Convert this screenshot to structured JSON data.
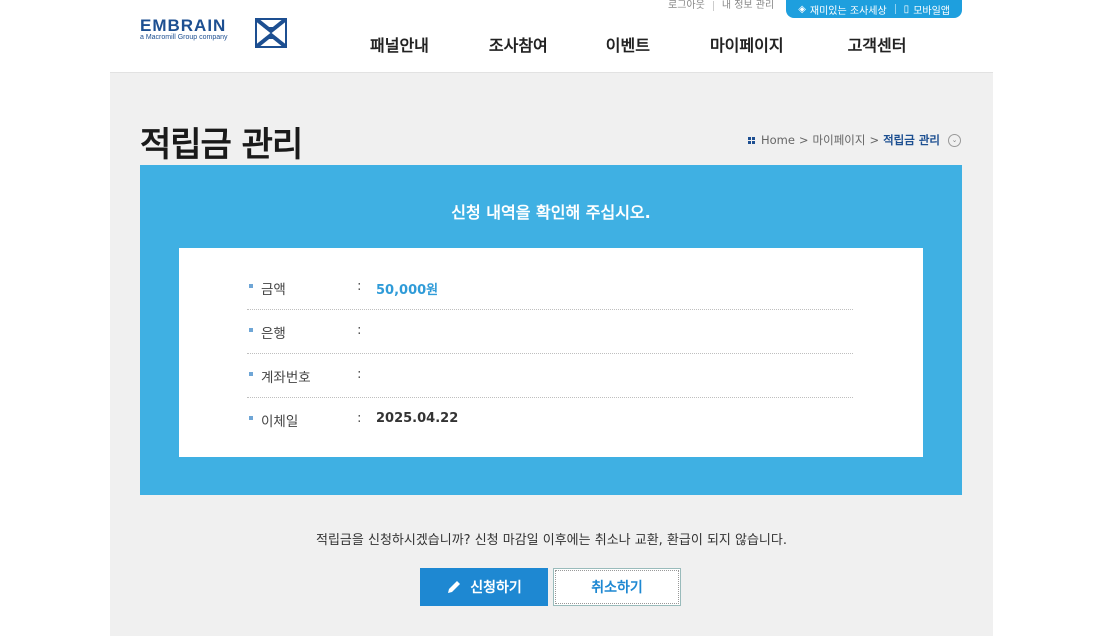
{
  "header": {
    "logo": {
      "name": "EMBRAIN",
      "sub": "a Macromill Group company"
    },
    "util_links": [
      "로그아웃",
      "내 정보 관리"
    ],
    "pill_links": [
      "재미있는 조사세상",
      "모바일앱"
    ],
    "nav": [
      "패널안내",
      "조사참여",
      "이벤트",
      "마이페이지",
      "고객센터"
    ]
  },
  "page": {
    "title": "적립금 관리",
    "breadcrumb": {
      "home": "Home",
      "sep": ">",
      "parent": "마이페이지",
      "current": "적립금 관리"
    }
  },
  "confirm": {
    "heading": "신청 내역을 확인해 주십시오.",
    "rows": [
      {
        "label": "금액",
        "colon": ":",
        "value": "50,000원"
      },
      {
        "label": "은행",
        "colon": ":",
        "value": ""
      },
      {
        "label": "계좌번호",
        "colon": ":",
        "value": ""
      },
      {
        "label": "이체일",
        "colon": ":",
        "value": "2025.04.22"
      }
    ]
  },
  "notice": "적립금을 신청하시겠습니까? 신청 마감일 이후에는 취소나 교환, 환급이 되지 않습니다.",
  "buttons": {
    "apply": "신청하기",
    "cancel": "취소하기"
  },
  "colors": {
    "accent": "#3fb0e3",
    "primary_button": "#1e88d2",
    "brand": "#1d4f91"
  }
}
